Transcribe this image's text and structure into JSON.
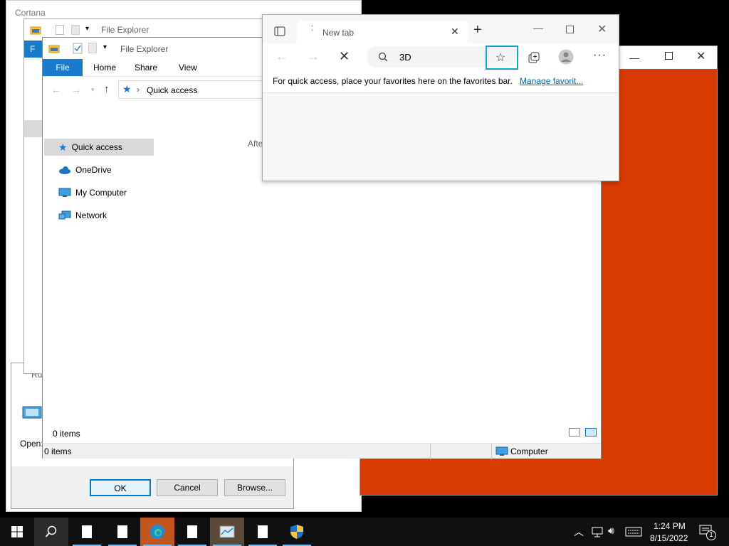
{
  "cortana": {
    "title": "Cortana"
  },
  "explorer_back": {
    "title": "File Explorer",
    "tab_file": "F"
  },
  "run_dialog": {
    "title": "Ru",
    "open_label": "Open:",
    "ok": "OK",
    "cancel": "Cancel",
    "browse": "Browse..."
  },
  "explorer": {
    "title": "File Explorer",
    "tabs": [
      "File",
      "Home",
      "Share",
      "View"
    ],
    "address": "Quick access",
    "nav": [
      "Quick access",
      "OneDrive",
      "My Computer",
      "Network"
    ],
    "content_text": "Afte",
    "items_count_inner": "0 items",
    "status_items": "0 items",
    "status_location": "Computer"
  },
  "edge": {
    "tab_title": "New tab",
    "address_text": "3D",
    "favorites_hint": "For quick access, place your favorites here on the favorites bar.",
    "manage_favorites": "Manage favorit..."
  },
  "taskbar": {
    "time": "1:24 PM",
    "date": "8/15/2022",
    "notification_count": "1"
  },
  "colors": {
    "orange": "#d83b01",
    "file_tab": "#1979ca",
    "highlight": "#0ea5d8",
    "taskbar": "#101010"
  }
}
